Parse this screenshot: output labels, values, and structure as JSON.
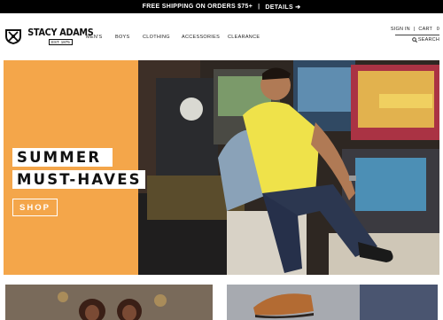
{
  "promo": {
    "shipping_text": "FREE SHIPPING ON ORDERS $75+",
    "separator": "|",
    "details_label": "DETAILS",
    "details_arrow": "➔"
  },
  "brand": {
    "name": "STACY ADAMS",
    "est": "EST. 1875",
    "logo_icon": "crossed-sword-crest"
  },
  "nav": {
    "items": [
      {
        "label": "MEN'S"
      },
      {
        "label": "BOYS"
      },
      {
        "label": "CLOTHING"
      },
      {
        "label": "ACCESSORIES"
      },
      {
        "label": "CLEARANCE"
      }
    ]
  },
  "utility": {
    "sign_in": "SIGN IN",
    "divider": "|",
    "cart_label": "CART",
    "cart_count": "0",
    "search_label": "SEARCH",
    "search_icon": "magnifier"
  },
  "hero": {
    "headline_1": "SUMMER",
    "headline_2": "MUST-HAVES",
    "cta_label": "SHOP",
    "panel_color": "#f4a64a"
  },
  "colors": {
    "topbar": "#000000",
    "text": "#111111",
    "accent": "#f4a64a"
  }
}
